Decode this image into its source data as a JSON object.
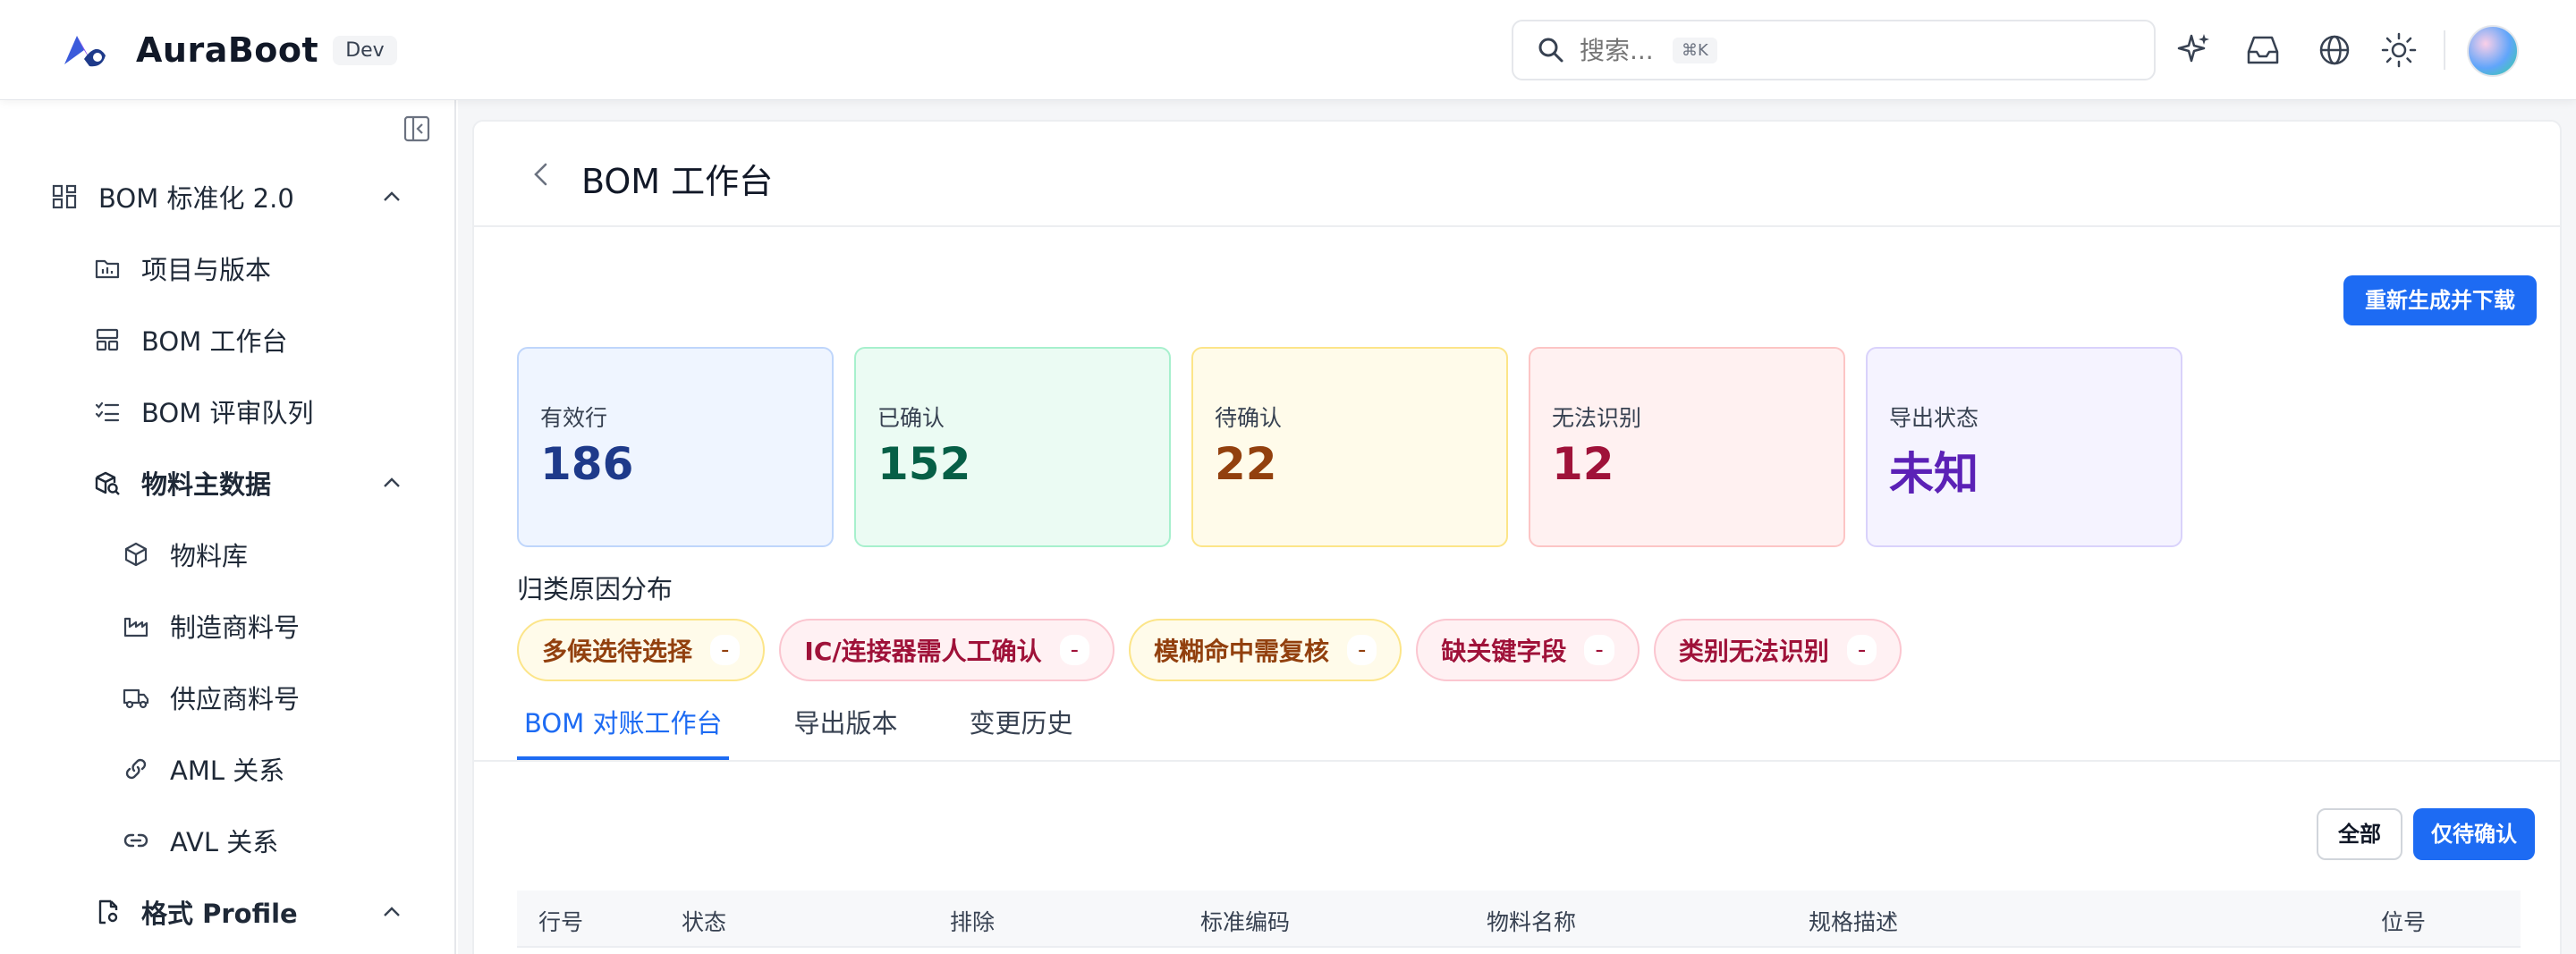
{
  "header": {
    "app_name": "AuraBoot",
    "env_badge": "Dev",
    "search": {
      "placeholder": "搜索...",
      "shortcut": "⌘K"
    },
    "icons": [
      "sparkle-icon",
      "inbox-icon",
      "globe-icon",
      "sun-icon"
    ]
  },
  "sidebar": {
    "groups": [
      {
        "label": "BOM 标准化 2.0",
        "icon": "grid-icon",
        "expanded": true
      },
      {
        "label": "项目与版本",
        "icon": "folder-icon"
      },
      {
        "label": "BOM 工作台",
        "icon": "layout-icon"
      },
      {
        "label": "BOM 评审队列",
        "icon": "checklist-icon"
      },
      {
        "label": "物料主数据",
        "icon": "package-search-icon",
        "expanded": true
      },
      {
        "label": "物料库",
        "icon": "box-icon"
      },
      {
        "label": "制造商料号",
        "icon": "factory-icon"
      },
      {
        "label": "供应商料号",
        "icon": "truck-icon"
      },
      {
        "label": "AML 关系",
        "icon": "link-icon"
      },
      {
        "label": "AVL 关系",
        "icon": "link2-icon"
      },
      {
        "label": "格式 Profile",
        "icon": "file-settings-icon",
        "expanded": true
      }
    ]
  },
  "page": {
    "title": "BOM 工作台",
    "regen_button": "重新生成并下载",
    "stats": [
      {
        "label": "有效行",
        "value": "186",
        "bg": "#eff5ff",
        "border": "#bfd6fb",
        "color": "#1e3a8a"
      },
      {
        "label": "已确认",
        "value": "152",
        "bg": "#ebfbf3",
        "border": "#a7f0cd",
        "color": "#065f46"
      },
      {
        "label": "待确认",
        "value": "22",
        "bg": "#fffbea",
        "border": "#fce589",
        "color": "#92400e"
      },
      {
        "label": "无法识别",
        "value": "12",
        "bg": "#fff1f1",
        "border": "#fcc5c5",
        "color": "#9f1239"
      },
      {
        "label": "导出状态",
        "value": "未知",
        "bg": "#f5f3ff",
        "border": "#d9d2fb",
        "color": "#5b21b6"
      }
    ],
    "reason_title": "归类原因分布",
    "reasons": [
      {
        "label": "多候选待选择",
        "count": "-",
        "bg": "#fffbea",
        "border": "#fce589",
        "color": "#92400e"
      },
      {
        "label": "IC/连接器需人工确认",
        "count": "-",
        "bg": "#fff1f3",
        "border": "#fbc6d0",
        "color": "#9f1239"
      },
      {
        "label": "模糊命中需复核",
        "count": "-",
        "bg": "#fffbea",
        "border": "#fce589",
        "color": "#92400e"
      },
      {
        "label": "缺关键字段",
        "count": "-",
        "bg": "#fff1f3",
        "border": "#fbc6d0",
        "color": "#9f1239"
      },
      {
        "label": "类别无法识别",
        "count": "-",
        "bg": "#fff1f3",
        "border": "#fbc6d0",
        "color": "#9f1239"
      }
    ],
    "tabs": [
      {
        "label": "BOM 对账工作台",
        "active": true
      },
      {
        "label": "导出版本",
        "active": false
      },
      {
        "label": "变更历史",
        "active": false
      }
    ],
    "filter_all": "全部",
    "filter_pending": "仅待确认",
    "table_headers": [
      "行号",
      "状态",
      "排除",
      "标准编码",
      "物料名称",
      "规格描述",
      "位号"
    ]
  }
}
